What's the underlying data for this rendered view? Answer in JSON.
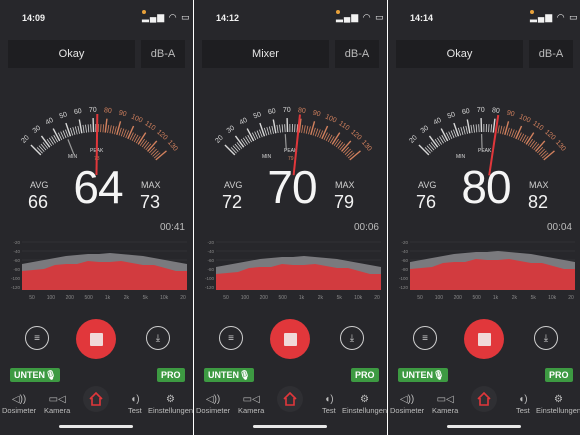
{
  "panels": [
    {
      "time": "14:09",
      "mode": "Okay",
      "unit": "dB-A",
      "avg_label": "AVG",
      "avg": "66",
      "big": "64",
      "max_label": "MAX",
      "max": "73",
      "timer": "00:41",
      "min_label": "MIN",
      "peak_label": "PEAK",
      "peak_value": "73",
      "needle_db": 73,
      "min_db": 47,
      "mic_label": "UNTEN",
      "pro_label": "PRO"
    },
    {
      "time": "14:12",
      "mode": "Mixer",
      "unit": "dB-A",
      "avg_label": "AVG",
      "avg": "72",
      "big": "70",
      "max_label": "MAX",
      "max": "79",
      "timer": "00:06",
      "min_label": "MIN",
      "peak_label": "PEAK",
      "peak_value": "79",
      "needle_db": 79,
      "min_db": 68,
      "mic_label": "UNTEN",
      "pro_label": "PRO"
    },
    {
      "time": "14:14",
      "mode": "Okay",
      "unit": "dB-A",
      "avg_label": "AVG",
      "avg": "76",
      "big": "80",
      "max_label": "MAX",
      "max": "82",
      "timer": "00:04",
      "min_label": "MIN",
      "peak_label": "PEAK",
      "peak_value": "",
      "needle_db": 82,
      "min_db": 70,
      "mic_label": "UNTEN",
      "pro_label": "PRO"
    }
  ],
  "gauge_scale": [
    "20",
    "30",
    "40",
    "50",
    "60",
    "70",
    "80",
    "90",
    "100",
    "110",
    "120",
    "130"
  ],
  "spectrum": {
    "y_ticks": [
      "-20",
      "-40",
      "-60",
      "-80",
      "-100",
      "-120"
    ],
    "x_ticks": [
      "50",
      "100",
      "200",
      "500",
      "1k",
      "2k",
      "5k",
      "10k",
      "20"
    ]
  },
  "tabs": {
    "dosimeter": "Dosimeter",
    "camera": "Kamera",
    "test": "Test",
    "settings": "Einstellungen"
  },
  "colors": {
    "accent_red": "#e1373b",
    "green_badge": "#3d9a42",
    "bg": "#27272b",
    "orange": "#d2815e"
  }
}
